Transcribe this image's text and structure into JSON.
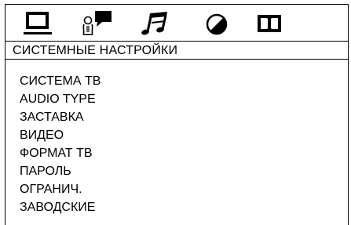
{
  "tabs": [
    {
      "icon": "monitor-icon",
      "selected": true
    },
    {
      "icon": "speaker-person-icon",
      "selected": false
    },
    {
      "icon": "music-note-icon",
      "selected": false
    },
    {
      "icon": "half-circle-icon",
      "selected": false
    },
    {
      "icon": "dolby-icon",
      "selected": false
    }
  ],
  "header": {
    "title": "СИСТЕМНЫЕ НАСТРОЙКИ"
  },
  "menu": {
    "items": [
      {
        "label": "СИСТЕМА ТВ"
      },
      {
        "label": "AUDIO TYPE"
      },
      {
        "label": "ЗАСТАВКА"
      },
      {
        "label": "ВИДЕО"
      },
      {
        "label": "ФОРМАТ ТВ"
      },
      {
        "label": "ПАРОЛЬ"
      },
      {
        "label": "ОГРАНИЧ."
      },
      {
        "label": "ЗАВОДСКИЕ"
      }
    ]
  },
  "colors": {
    "foreground": "#000000",
    "background": "#ffffff"
  }
}
